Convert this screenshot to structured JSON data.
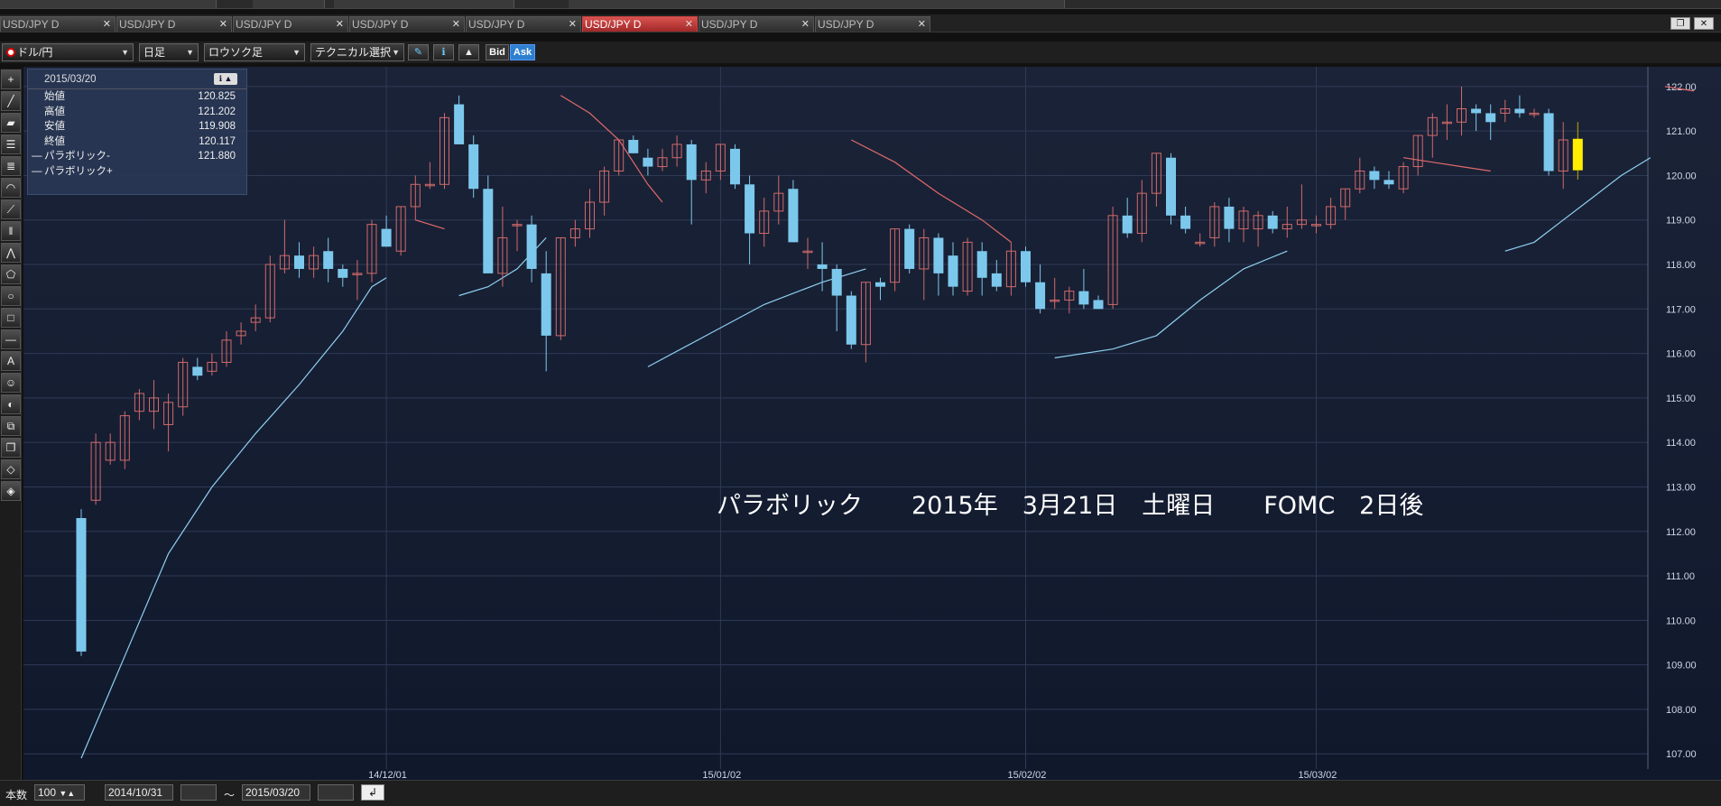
{
  "tabs": [
    {
      "label": "USD/JPY D",
      "active": false
    },
    {
      "label": "USD/JPY D",
      "active": false
    },
    {
      "label": "USD/JPY D",
      "active": false
    },
    {
      "label": "USD/JPY D",
      "active": false
    },
    {
      "label": "USD/JPY D",
      "active": false
    },
    {
      "label": "USD/JPY D",
      "active": true
    },
    {
      "label": "USD/JPY D",
      "active": false
    },
    {
      "label": "USD/JPY D",
      "active": false
    }
  ],
  "toolbar": {
    "pair": "ドル/円",
    "timeframe": "日足",
    "chart_type": "ロウソク足",
    "technical": "テクニカル選択",
    "bid": "Bid",
    "ask": "Ask"
  },
  "info": {
    "date": "2015/03/20",
    "rows": [
      {
        "label": "始値",
        "value": "120.825",
        "mark": ""
      },
      {
        "label": "高値",
        "value": "121.202",
        "mark": ""
      },
      {
        "label": "安値",
        "value": "119.908",
        "mark": ""
      },
      {
        "label": "終値",
        "value": "120.117",
        "mark": ""
      },
      {
        "label": "パラボリック-",
        "value": "121.880",
        "mark": "—"
      },
      {
        "label": "パラボリック+",
        "value": "",
        "mark": "—"
      }
    ]
  },
  "annotation": "パラボリック　　2015年　3月21日　土曜日　　FOMC　2日後",
  "bottom": {
    "count_label": "本数",
    "count_value": "100",
    "from_date": "2014/10/31",
    "tilde": "～",
    "to_date": "2015/03/20"
  },
  "colors": {
    "up": "#d06a6a",
    "down": "#7cc8ec",
    "last": "#ffee00",
    "sar_minus": "#e06a6a",
    "sar_plus": "#8fd0f0",
    "grid": "#2e3a55"
  },
  "chart_data": {
    "type": "candlestick",
    "ylim": [
      106.7,
      122.2
    ],
    "yticks": [
      107,
      108,
      109,
      110,
      111,
      112,
      113,
      114,
      115,
      116,
      117,
      118,
      119,
      120,
      121,
      122
    ],
    "ytick_labels": [
      "107.00",
      "108.00",
      "109.00",
      "110.00",
      "111.00",
      "112.00",
      "113.00",
      "114.00",
      "115.00",
      "116.00",
      "117.00",
      "118.00",
      "119.00",
      "120.00",
      "121.00",
      "122.00"
    ],
    "xlabels": [
      {
        "index": 21,
        "label": "14/12/01"
      },
      {
        "index": 44,
        "label": "15/01/02"
      },
      {
        "index": 65,
        "label": "15/02/02"
      },
      {
        "index": 85,
        "label": "15/03/02"
      }
    ],
    "candles": [
      [
        112.3,
        112.5,
        109.2,
        109.3
      ],
      [
        112.7,
        114.2,
        112.6,
        114.0
      ],
      [
        113.6,
        114.2,
        113.5,
        114.0
      ],
      [
        113.6,
        114.7,
        113.4,
        114.6
      ],
      [
        114.7,
        115.2,
        114.5,
        115.1
      ],
      [
        114.7,
        115.4,
        114.3,
        115.0
      ],
      [
        114.4,
        115.1,
        113.8,
        114.9
      ],
      [
        114.8,
        115.9,
        114.6,
        115.8
      ],
      [
        115.7,
        115.9,
        115.4,
        115.5
      ],
      [
        115.6,
        116.0,
        115.5,
        115.8
      ],
      [
        115.8,
        116.5,
        115.7,
        116.3
      ],
      [
        116.4,
        116.7,
        116.2,
        116.5
      ],
      [
        116.7,
        117.1,
        116.5,
        116.8
      ],
      [
        116.8,
        118.2,
        116.7,
        118.0
      ],
      [
        117.9,
        119.0,
        117.8,
        118.2
      ],
      [
        118.2,
        118.5,
        117.7,
        117.9
      ],
      [
        117.9,
        118.4,
        117.7,
        118.2
      ],
      [
        118.3,
        118.6,
        117.6,
        117.9
      ],
      [
        117.9,
        118.0,
        117.5,
        117.7
      ],
      [
        117.8,
        118.1,
        117.2,
        117.8
      ],
      [
        117.8,
        119.0,
        117.6,
        118.9
      ],
      [
        118.8,
        119.1,
        118.4,
        118.4
      ],
      [
        118.3,
        119.3,
        118.2,
        119.3
      ],
      [
        119.3,
        120.0,
        119.0,
        119.8
      ],
      [
        119.8,
        120.3,
        119.7,
        119.8
      ],
      [
        119.8,
        121.4,
        119.7,
        121.3
      ],
      [
        121.6,
        121.8,
        120.7,
        120.7
      ],
      [
        120.7,
        120.9,
        119.5,
        119.7
      ],
      [
        119.7,
        120.0,
        117.9,
        117.8
      ],
      [
        117.8,
        119.3,
        117.5,
        118.6
      ],
      [
        118.9,
        119.0,
        118.3,
        118.9
      ],
      [
        118.9,
        119.1,
        117.6,
        117.9
      ],
      [
        117.8,
        118.3,
        115.6,
        116.4
      ],
      [
        116.4,
        118.6,
        116.3,
        118.6
      ],
      [
        118.6,
        119.0,
        118.4,
        118.8
      ],
      [
        118.8,
        119.7,
        118.6,
        119.4
      ],
      [
        119.4,
        120.2,
        119.1,
        120.1
      ],
      [
        120.1,
        120.8,
        120.0,
        120.8
      ],
      [
        120.8,
        120.9,
        120.5,
        120.5
      ],
      [
        120.4,
        120.6,
        120.0,
        120.2
      ],
      [
        120.2,
        120.6,
        120.1,
        120.4
      ],
      [
        120.4,
        120.9,
        120.2,
        120.7
      ],
      [
        120.7,
        120.8,
        118.9,
        119.9
      ],
      [
        119.9,
        120.3,
        119.6,
        120.1
      ],
      [
        120.1,
        120.7,
        119.9,
        120.7
      ],
      [
        120.6,
        120.7,
        119.7,
        119.8
      ],
      [
        119.8,
        120.0,
        118.0,
        118.7
      ],
      [
        118.7,
        119.5,
        118.4,
        119.2
      ],
      [
        119.2,
        120.0,
        118.9,
        119.6
      ],
      [
        119.7,
        119.9,
        118.5,
        118.5
      ],
      [
        118.3,
        118.6,
        117.9,
        118.3
      ],
      [
        118.0,
        118.5,
        117.4,
        117.9
      ],
      [
        117.9,
        118.0,
        116.5,
        117.3
      ],
      [
        117.3,
        117.4,
        116.1,
        116.2
      ],
      [
        116.2,
        117.6,
        115.8,
        117.6
      ],
      [
        117.6,
        117.7,
        117.2,
        117.5
      ],
      [
        117.6,
        118.8,
        117.4,
        118.8
      ],
      [
        118.8,
        118.9,
        117.8,
        117.9
      ],
      [
        117.9,
        118.8,
        117.2,
        118.6
      ],
      [
        118.6,
        118.7,
        117.3,
        117.8
      ],
      [
        118.2,
        118.5,
        117.3,
        117.5
      ],
      [
        117.4,
        118.6,
        117.3,
        118.5
      ],
      [
        118.3,
        118.5,
        117.3,
        117.7
      ],
      [
        117.8,
        118.1,
        117.4,
        117.5
      ],
      [
        117.5,
        118.5,
        117.3,
        118.3
      ],
      [
        118.3,
        118.4,
        117.5,
        117.6
      ],
      [
        117.6,
        118.0,
        116.9,
        117.0
      ],
      [
        117.2,
        117.7,
        117.0,
        117.2
      ],
      [
        117.2,
        117.5,
        116.9,
        117.4
      ],
      [
        117.4,
        117.9,
        117.0,
        117.1
      ],
      [
        117.2,
        117.3,
        117.0,
        117.0
      ],
      [
        117.1,
        119.3,
        117.0,
        119.1
      ],
      [
        119.1,
        119.5,
        118.6,
        118.7
      ],
      [
        118.7,
        119.9,
        118.5,
        119.6
      ],
      [
        119.6,
        120.5,
        119.3,
        120.5
      ],
      [
        120.4,
        120.5,
        118.9,
        119.1
      ],
      [
        119.1,
        119.3,
        118.7,
        118.8
      ],
      [
        118.5,
        118.7,
        118.4,
        118.5
      ],
      [
        118.6,
        119.4,
        118.4,
        119.3
      ],
      [
        119.3,
        119.5,
        118.5,
        118.8
      ],
      [
        118.8,
        119.3,
        118.5,
        119.2
      ],
      [
        118.8,
        119.2,
        118.4,
        119.1
      ],
      [
        119.1,
        119.2,
        118.7,
        118.8
      ],
      [
        118.8,
        119.3,
        118.6,
        118.9
      ],
      [
        118.9,
        119.8,
        118.8,
        119.0
      ],
      [
        118.9,
        119.1,
        118.7,
        118.9
      ],
      [
        118.9,
        119.5,
        118.8,
        119.3
      ],
      [
        119.3,
        119.7,
        119.0,
        119.7
      ],
      [
        119.7,
        120.4,
        119.6,
        120.1
      ],
      [
        120.1,
        120.2,
        119.7,
        119.9
      ],
      [
        119.9,
        120.1,
        119.7,
        119.8
      ],
      [
        119.7,
        120.3,
        119.6,
        120.2
      ],
      [
        120.2,
        120.9,
        120.0,
        120.9
      ],
      [
        120.9,
        121.4,
        120.4,
        121.3
      ],
      [
        121.2,
        121.6,
        120.8,
        121.2
      ],
      [
        121.2,
        122.0,
        120.9,
        121.5
      ],
      [
        121.5,
        121.6,
        121.0,
        121.4
      ],
      [
        121.4,
        121.6,
        120.8,
        121.2
      ],
      [
        121.4,
        121.7,
        121.2,
        121.5
      ],
      [
        121.5,
        121.8,
        121.3,
        121.4
      ],
      [
        121.4,
        121.5,
        121.3,
        121.4
      ],
      [
        121.4,
        121.5,
        120.0,
        120.1
      ],
      [
        120.1,
        121.2,
        119.7,
        120.8
      ],
      [
        120.825,
        121.202,
        119.908,
        120.117
      ]
    ],
    "sar_plus_segments": [
      [
        [
          0,
          106.9
        ],
        [
          3,
          109.2
        ],
        [
          6,
          111.5
        ],
        [
          9,
          113.0
        ],
        [
          12,
          114.2
        ],
        [
          15,
          115.3
        ],
        [
          18,
          116.5
        ],
        [
          20,
          117.5
        ],
        [
          21,
          117.7
        ]
      ],
      [
        [
          26,
          117.3
        ],
        [
          28,
          117.5
        ],
        [
          30,
          117.9
        ],
        [
          32,
          118.6
        ]
      ],
      [
        [
          39,
          115.7
        ],
        [
          43,
          116.4
        ],
        [
          47,
          117.1
        ],
        [
          51,
          117.6
        ],
        [
          54,
          117.9
        ]
      ],
      [
        [
          67,
          115.9
        ],
        [
          71,
          116.1
        ],
        [
          74,
          116.4
        ],
        [
          77,
          117.2
        ],
        [
          80,
          117.9
        ],
        [
          83,
          118.3
        ]
      ],
      [
        [
          98,
          118.3
        ],
        [
          100,
          118.5
        ],
        [
          102,
          119.0
        ],
        [
          104,
          119.5
        ],
        [
          106,
          120.0
        ],
        [
          108,
          120.4
        ]
      ]
    ],
    "sar_minus_segments": [
      [
        [
          23,
          119.0
        ],
        [
          25,
          118.8
        ]
      ],
      [
        [
          33,
          121.8
        ],
        [
          35,
          121.4
        ],
        [
          37,
          120.8
        ],
        [
          39,
          119.8
        ],
        [
          40,
          119.4
        ]
      ],
      [
        [
          53,
          120.8
        ],
        [
          56,
          120.3
        ],
        [
          59,
          119.6
        ],
        [
          62,
          119.0
        ],
        [
          64,
          118.5
        ]
      ],
      [
        [
          91,
          120.4
        ],
        [
          93,
          120.3
        ],
        [
          95,
          120.2
        ],
        [
          97,
          120.1
        ]
      ],
      [
        [
          109,
          122.0
        ],
        [
          111,
          121.9
        ]
      ]
    ]
  }
}
